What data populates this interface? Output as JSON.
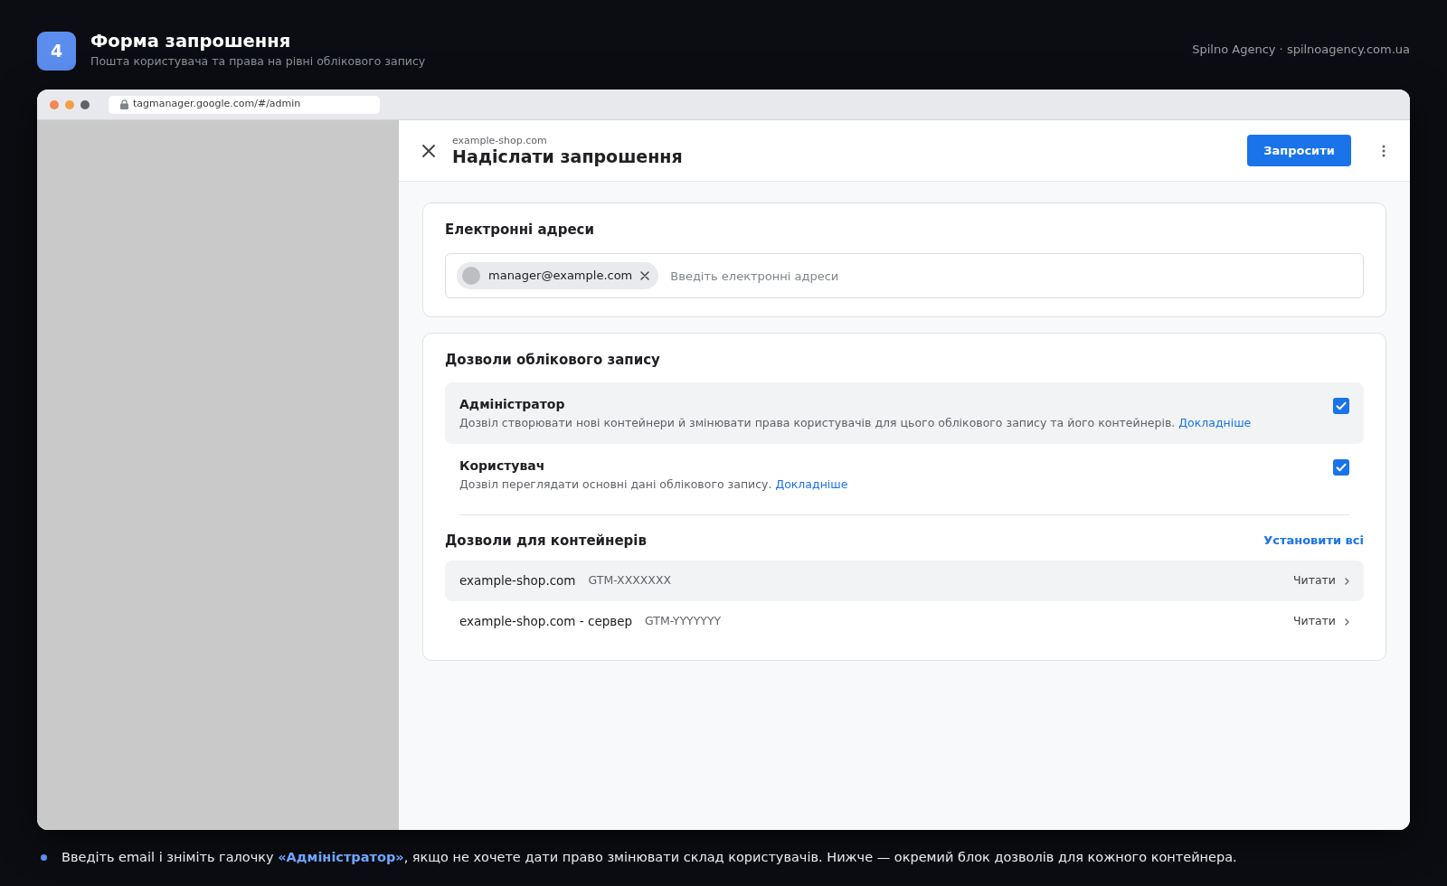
{
  "header": {
    "step": "4",
    "title": "Форма запрошення",
    "subtitle": "Пошта користувача та права на рівні облікового запису",
    "credit": "Spilno Agency · spilnoagency.com.ua"
  },
  "browser": {
    "url": "tagmanager.google.com/#/admin"
  },
  "dialog": {
    "account": "example-shop.com",
    "title": "Надіслати запрошення",
    "primary_button": "Запросити",
    "emails": {
      "title": "Електронні адреси",
      "chips": [
        {
          "label": "manager@example.com"
        }
      ],
      "placeholder": "Введіть електронні адреси"
    },
    "account_permissions": {
      "title": "Дозволи облікового запису",
      "items": [
        {
          "name": "Адміністратор",
          "description": "Дозвіл створювати нові контейнери й змінювати права користувачів для цього облікового запису та його контейнерів.",
          "link": "Докладніше",
          "checked": true,
          "highlighted": true
        },
        {
          "name": "Користувач",
          "description": "Дозвіл переглядати основні дані облікового запису.",
          "link": "Докладніше",
          "checked": true,
          "highlighted": false
        }
      ]
    },
    "container_permissions": {
      "title": "Дозволи для контейнерів",
      "action": "Установити всі",
      "rows": [
        {
          "name": "example-shop.com",
          "id": "GTM-XXXXXXX",
          "access": "Читати",
          "highlighted": true
        },
        {
          "name": "example-shop.com - сервер",
          "id": "GTM-YYYYYYY",
          "access": "Читати",
          "highlighted": false
        }
      ]
    }
  },
  "caption": "Введіть email і зніміть галочку **«Адміністратор»**, якщо не хочете дати право змінювати склад користувачів. Нижче — окремий блок дозволів для кожного контейнера."
}
